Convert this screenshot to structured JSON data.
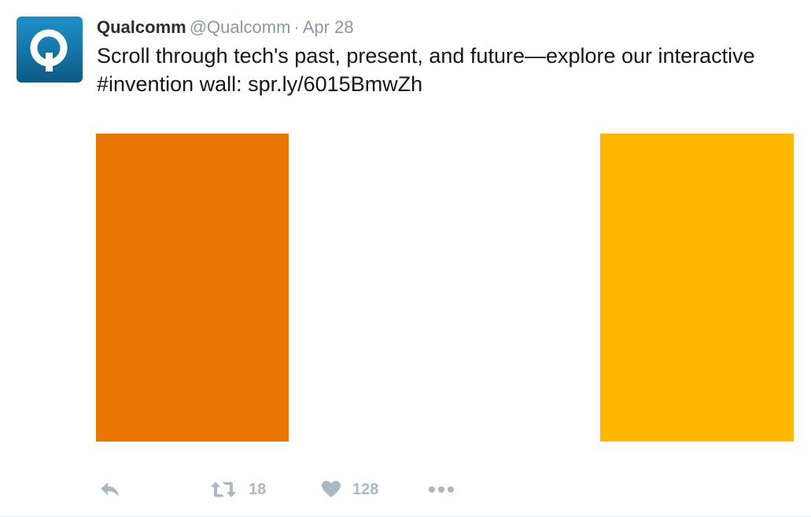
{
  "tweet": {
    "author": {
      "name": "Qualcomm",
      "handle": "@Qualcomm",
      "avatar_letter": "Q"
    },
    "separator": "·",
    "date": "Apr 28",
    "text_lines": [
      "Scroll through tech's past, present, and future—explore our interactive",
      "#invention wall: spr.ly/6015BmwZh"
    ],
    "media": {
      "left_panel_color": "#e97502",
      "right_panel_color": "#ffb800",
      "background_color": "#ffffff"
    },
    "actions": {
      "reply_icon": "reply-icon",
      "retweet_icon": "retweet-icon",
      "retweet_count": "18",
      "like_icon": "heart-icon",
      "like_count": "128",
      "more_icon": "more-dots-icon"
    },
    "colors": {
      "name": "#292f33",
      "meta": "#8899a6",
      "action": "#aab8c2",
      "avatar": "#1679ad"
    }
  }
}
